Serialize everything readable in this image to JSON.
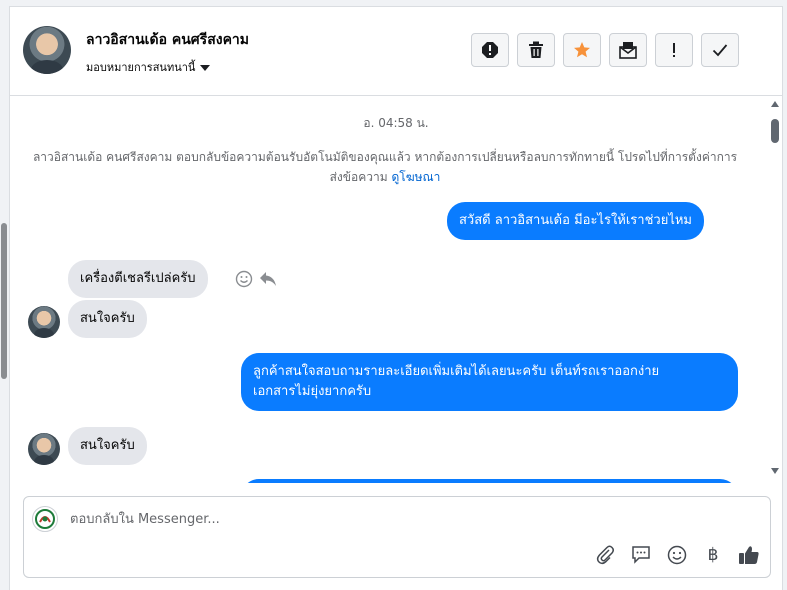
{
  "header": {
    "contact_name": "ลาวอิสานเด้อ คนศรีสงคาม",
    "assign_label": "มอบหมายการสนทนานี้"
  },
  "chat": {
    "timestamp": "อ. 04:58 น.",
    "system_text": "ลาวอิสานเด้อ คนศรีสงคาม ตอบกลับข้อความต้อนรับอัตโนมัติของคุณแล้ว หากต้องการเปลี่ยนหรือลบการทักทายนี้ โปรดไปที่การตั้งค่าการส่งข้อความ",
    "system_link": "ดูโฆษณา",
    "messages": [
      {
        "dir": "out",
        "text": "สวัสดี ลาวอิสานเด้อ มีอะไรให้เราช่วยไหม"
      },
      {
        "dir": "in",
        "text": "เครื่องตีเชลรีเปล่ครับ"
      },
      {
        "dir": "in",
        "text": "สนใจครับ"
      },
      {
        "dir": "out",
        "text": "ลูกค้าสนใจสอบถามรายละเอียดเพิ่มเติมได้เลยนะครับ เต็นท์รถเราออกง่าย",
        "text2": "เอกสารไม่ยุ่งยากครับ"
      },
      {
        "dir": "in",
        "text": "สนใจครับ"
      }
    ]
  },
  "composer": {
    "placeholder": "ตอบกลับใน Messenger..."
  },
  "colors": {
    "outgoing_bubble": "#0a7cff",
    "incoming_bubble": "#e4e6eb",
    "star_active": "#f7923a"
  },
  "icons": [
    "spam-icon",
    "trash-icon",
    "star-icon",
    "mark-unread-icon",
    "follow-up-icon",
    "done-icon",
    "emoji-icon",
    "reply-icon",
    "attachment-icon",
    "saved-reply-icon",
    "smiley-icon",
    "baht-icon",
    "like-icon"
  ]
}
